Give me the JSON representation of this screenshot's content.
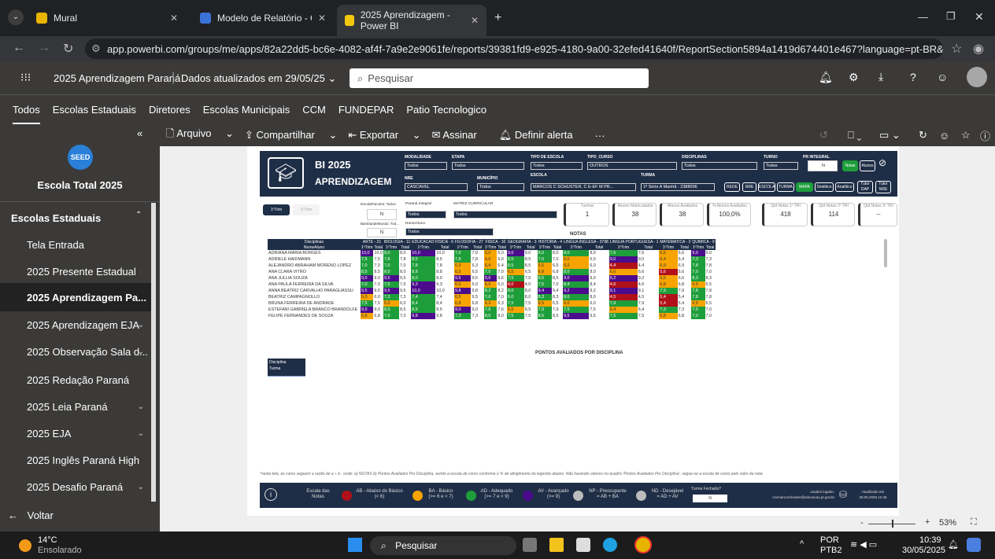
{
  "browser": {
    "tabs": [
      {
        "title": "Mural"
      },
      {
        "title": "Modelo de Relatório - Ciência d"
      },
      {
        "title": "2025 Aprendizagem - Power BI"
      }
    ],
    "url": "app.powerbi.com/groups/me/apps/82a22dd5-bc6e-4082-af4f-7a9e2e9061fe/reports/39381fd9-e925-4180-9a00-32efed41640f/ReportSection5894a1419d674401e467?language=pt-BR&experience=po..."
  },
  "pbi": {
    "app_title": "2025 Aprendizagem Paraná",
    "updated": "Dados atualizados em 29/05/25",
    "search_placeholder": "Pesquisar",
    "nav": [
      "Todos",
      "Escolas Estaduais",
      "Diretores",
      "Escolas Municipais",
      "CCM",
      "FUNDEPAR",
      "Patio Tecnologico"
    ]
  },
  "sidebar": {
    "logo": "SEED",
    "title": "Escola Total 2025",
    "section": "Escolas Estaduais",
    "items": [
      "Tela Entrada",
      "2025 Presente Estadual",
      "2025 Aprendizagem Pa...",
      "2025 Aprendizagem EJA",
      "2025 Observação Sala d...",
      "2025 Redação Paraná",
      "2025 Leia Paraná",
      "2025 EJA",
      "2025 Inglês Paraná High",
      "2025 Desafio Paraná"
    ],
    "back": "Voltar"
  },
  "toolbar": {
    "arquivo": "Arquivo",
    "compartilhar": "Compartilhar",
    "exportar": "Exportar",
    "assinar": "Assinar",
    "alerta": "Definir alerta",
    "more": "···"
  },
  "report": {
    "title1": "BI 2025",
    "title2": "APRENDIZAGEM",
    "filters": {
      "modalidade": {
        "label": "MODALIDADE",
        "value": "Todos"
      },
      "etapa": {
        "label": "ETAPA",
        "value": "Todos"
      },
      "tipo_escola": {
        "label": "TIPO DE ESCOLA",
        "value": "Todos"
      },
      "tipo_curso": {
        "label": "TIPO_CURSO",
        "value": "OUTROS"
      },
      "disciplinas": {
        "label": "DISCIPLINAS",
        "value": "Todos"
      },
      "turno": {
        "label": "TURNO",
        "value": "Todos"
      },
      "pr_integral": {
        "label": "PR INTEGRAL",
        "value": "N"
      },
      "nre": {
        "label": "NRE",
        "value": "CASCAVEL"
      },
      "municipio": {
        "label": "MUNICÍPIO",
        "value": "Todos"
      },
      "escola": {
        "label": "ESCOLA",
        "value": "MARCOS C SCHUSTER, C E-EF M PR..."
      },
      "turma": {
        "label": "TURMA",
        "value": "1ª Série A Manhã - 2388096"
      }
    },
    "buttons": [
      "Notas",
      "Alunos",
      "REDE",
      "NRE",
      "ESCOLA",
      "TURMA",
      "MAPA",
      "Sintético",
      "Analítico",
      "Tutor DAP",
      "Tutor NRE"
    ],
    "trim_tabs": [
      "1ºTrim",
      "2ºTrim"
    ],
    "sub_filters": {
      "escola_parceira": {
        "label": "EscolaParceira: Todos",
        "value": "N"
      },
      "parana_integral": {
        "label": "Paraná Integral",
        "value": "Todos"
      },
      "matriz": {
        "label": "MATRIZ CURRICULAR",
        "value": "Todos"
      },
      "bamb": {
        "label": "BambandeMundo: Tod...",
        "value": "N"
      },
      "nome_aluno": {
        "label": "NomeAluno",
        "value": "Todos"
      }
    },
    "cards": [
      {
        "label": "Turmas",
        "value": "1"
      },
      {
        "label": "Alunos Matriculados",
        "value": "38"
      },
      {
        "label": "Alunos Avaliados",
        "value": "38"
      },
      {
        "label": "% Alunos Avaliados",
        "value": "100,0%"
      },
      {
        "label": "Qtd Notas 1º TRI",
        "value": "418"
      },
      {
        "label": "Qtd Notas 2º TRI",
        "value": "114"
      },
      {
        "label": "Qtd Notas 3º TRI",
        "value": "--"
      }
    ],
    "table_title": "NOTAS",
    "subjects": [
      "ARTE - 21",
      "BIOLOGIA - 11",
      "EDUCACAO FISICA - 6",
      "FILOSOFIA - 27",
      "FISICA - 10",
      "GEOGRAFIA - 3",
      "HISTORIA - 4",
      "LINGUA INGLESA - 3798",
      "LINGUA PORTUGUESA - 1",
      "MATEMATICA - 2",
      "QUIMICA - 9"
    ],
    "col_labels": {
      "disc": "Disciplinas",
      "nome": "NomeAluno",
      "t1": "1ºTrim",
      "total": "Total"
    },
    "students": [
      "ADRIANA MARIA BORGES",
      "ADRIELE HAIDMANN",
      "ALEJANDRO ABRAHAM MORENO LOPEZ",
      "ANA CLARA VITRO",
      "ANA JULLIA SOUZA",
      "ANA PAULA FERREIRA DA SILVA",
      "ANNA BEATRIZ CARVALHO PARAGUASSU",
      "BEATRIZ CAMPAGNOLLO",
      "BRUNA FERREIRA DE ANDRADE",
      "ESTEFANI GABRIELA BRANCO BRANDOLFE",
      "FELIPE FERNANDES DE SOUZA"
    ],
    "grades": [
      [
        "10,0",
        "10,0",
        "8,0",
        "8,0",
        "10,0",
        "10,0",
        "7,0",
        "7,0",
        "6,0",
        "6,0",
        "9,0",
        "9,0",
        "8,0",
        "8,0",
        "8,0",
        "8,0",
        "7,6",
        "7,6",
        "6,6",
        "6,6",
        "9,0",
        "9,0"
      ],
      [
        "7,5",
        "7,5",
        "7,8",
        "7,8",
        "8,5",
        "8,5",
        "7,8",
        "7,8",
        "6,0",
        "6,0",
        "8,5",
        "8,5",
        "7,0",
        "7,0",
        "6,0",
        "6,0",
        "9,0",
        "9,0",
        "6,4",
        "6,4",
        "7,3",
        "7,3"
      ],
      [
        "7,0",
        "7,0",
        "7,0",
        "7,0",
        "7,8",
        "7,8",
        "6,3",
        "6,3",
        "6,4",
        "6,4",
        "8,5",
        "8,5",
        "6,5",
        "6,5",
        "6,0",
        "6,0",
        "4,4",
        "4,4",
        "6,9",
        "6,9",
        "7,8",
        "7,8"
      ],
      [
        "8,5",
        "8,5",
        "8,0",
        "8,0",
        "8,8",
        "8,8",
        "6,5",
        "6,5",
        "7,0",
        "7,0",
        "6,5",
        "6,5",
        "6,8",
        "6,8",
        "8,0",
        "8,0",
        "6,6",
        "6,6",
        "5,6",
        "5,6",
        "7,0",
        "7,0"
      ],
      [
        "9,0",
        "9,0",
        "9,5",
        "9,5",
        "8,0",
        "8,0",
        "9,5",
        "9,5",
        "9,6",
        "9,6",
        "7,5",
        "7,5",
        "8,5",
        "8,5",
        "9,0",
        "9,0",
        "9,2",
        "9,2",
        "6,6",
        "6,6",
        "8,3",
        "8,3"
      ],
      [
        "7,0",
        "7,0",
        "7,5",
        "7,5",
        "9,3",
        "9,3",
        "6,0",
        "6,0",
        "6,0",
        "6,0",
        "4,0",
        "4,0",
        "7,5",
        "7,5",
        "8,4",
        "8,4",
        "4,6",
        "4,6",
        "6,8",
        "6,8",
        "6,5",
        "6,5"
      ],
      [
        "9,5",
        "9,5",
        "9,5",
        "9,5",
        "10,0",
        "10,0",
        "9,8",
        "9,8",
        "8,2",
        "8,2",
        "8,0",
        "8,0",
        "9,4",
        "9,4",
        "9,2",
        "9,2",
        "9,1",
        "9,1",
        "7,9",
        "7,9",
        "7,8",
        "7,8"
      ],
      [
        "6,0",
        "6,0",
        "7,3",
        "7,3",
        "7,4",
        "7,4",
        "6,5",
        "6,5",
        "7,0",
        "7,0",
        "8,0",
        "8,0",
        "8,3",
        "8,3",
        "8,0",
        "8,0",
        "4,5",
        "4,5",
        "5,4",
        "5,4",
        "7,8",
        "7,8"
      ],
      [
        "7,5",
        "7,5",
        "6,0",
        "6,0",
        "8,4",
        "8,4",
        "6,8",
        "6,8",
        "6,3",
        "6,3",
        "7,5",
        "7,5",
        "6,5",
        "6,5",
        "6,0",
        "6,0",
        "7,9",
        "7,9",
        "5,4",
        "5,4",
        "6,5",
        "6,5"
      ],
      [
        "9,0",
        "9,0",
        "8,5",
        "8,5",
        "8,5",
        "8,5",
        "9,0",
        "9,0",
        "7,6",
        "7,6",
        "6,5",
        "6,5",
        "7,9",
        "7,9",
        "7,5",
        "7,5",
        "6,4",
        "6,4",
        "7,3",
        "7,3",
        "7,0",
        "7,0"
      ],
      [
        "6,8",
        "6,8",
        "7,0",
        "7,0",
        "9,8",
        "9,8",
        "7,3",
        "7,3",
        "8,0",
        "8,0",
        "7,5",
        "7,5",
        "8,5",
        "8,5",
        "9,5",
        "9,5",
        "7,5",
        "7,5",
        "6,8",
        "6,8",
        "7,0",
        "7,0"
      ]
    ],
    "chart_title": "PONTOS AVALIADOS POR DISCIPLINA",
    "chart_slicer": [
      "Disciplina",
      "Turma"
    ],
    "footnote": "*nesta tela, as cores seguem a razão de a ÷ b , onde: a) NOTAS b) Pontos Availados Por Disciplina, sendo a escala de cores conforme o % de atingimento da legenda abaixo. Não havendo valores no quadro 'Pontos Availados Por Disciplina', segue-se a escala de cores pelo valor da nota.",
    "legend": {
      "title": "Escala das Notas",
      "items": [
        {
          "name": "AB - Abaixo do Básico",
          "range": "(< 6)",
          "color": "#b0101a"
        },
        {
          "name": "BA - Básico",
          "range": "(>= 6 e < 7)",
          "color": "#f7a400"
        },
        {
          "name": "AD - Adequado",
          "range": "(>= 7 e < 9)",
          "color": "#1e9e3a"
        },
        {
          "name": "AV - Avançado",
          "range": "(>= 9)",
          "color": "#4b0b8c"
        },
        {
          "name": "NP - Preocupante",
          "range": "= AB + BA",
          "color": "#bbbbbb"
        },
        {
          "name": "ND - Desejável",
          "range": "= AD + AV",
          "color": "#bbbbbb"
        }
      ],
      "turma_fechada": "Turma Fechada?",
      "turma_value": "N",
      "user_label": "usuário logado:",
      "user": "cscmarcoschuster@educacao.pr.gov.br",
      "updated_label": "Atualizado em",
      "updated": "29.05.2025 12:45"
    }
  },
  "status": {
    "zoom": "53%"
  },
  "taskbar": {
    "temp": "14°C",
    "weather": "Ensolarado",
    "search": "Pesquisar",
    "lang1": "POR",
    "lang2": "PTB2",
    "time": "10:39",
    "date": "30/05/2025"
  }
}
